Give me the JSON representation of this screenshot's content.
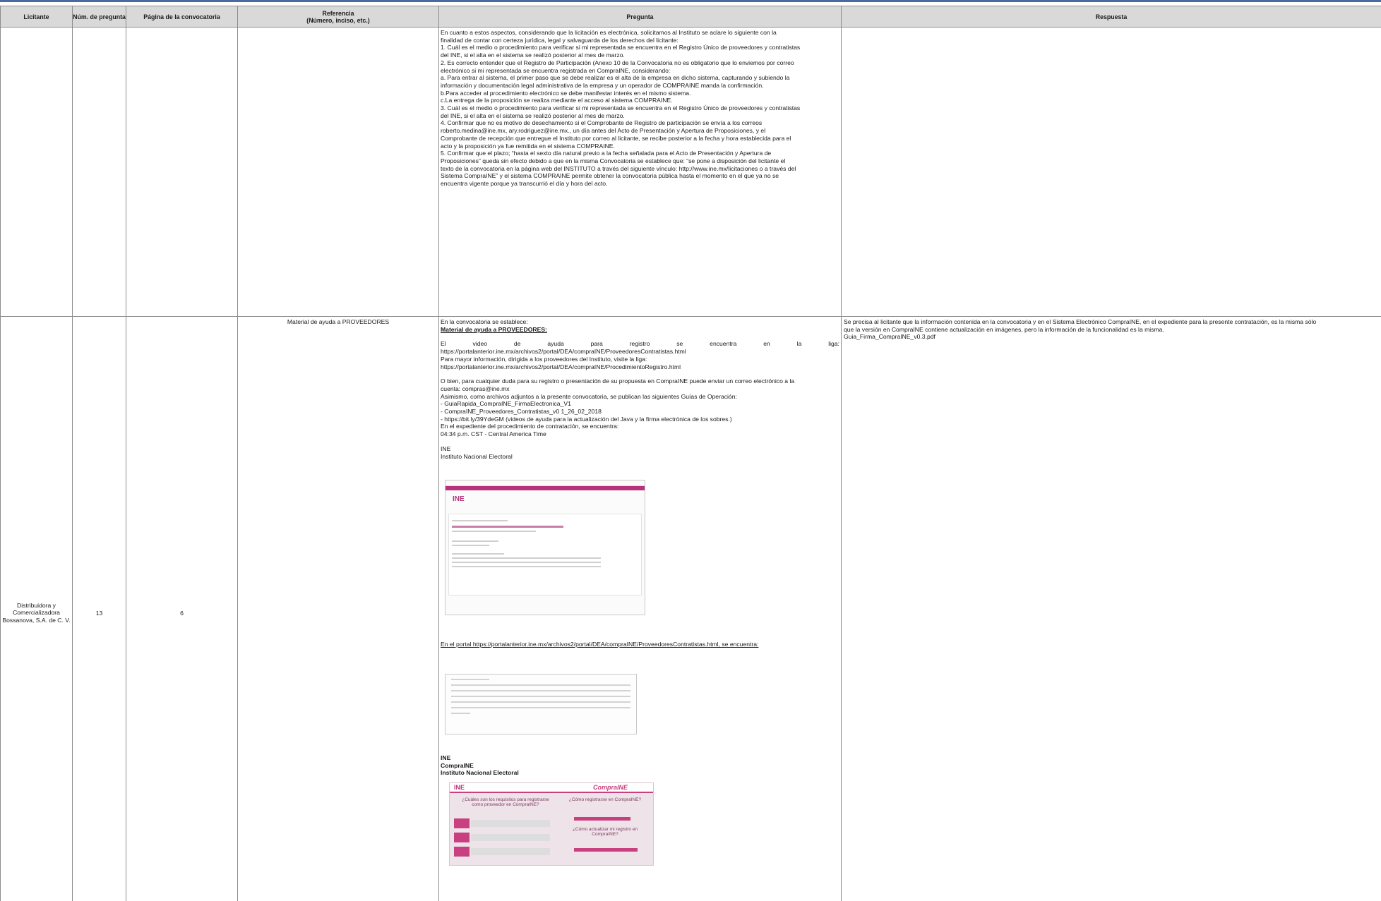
{
  "table": {
    "headers": {
      "licitante": "Licitante",
      "num_pregunta": "Núm. de pregunta",
      "pagina": "Página de la convocatoria",
      "referencia_l1": "Referencia",
      "referencia_l2": "(Número, inciso, etc.)",
      "pregunta": "Pregunta",
      "respuesta": "Respuesta"
    },
    "row1": {
      "pregunta_lines": [
        "En cuanto a estos aspectos, considerando que la licitación es electrónica, solicitamos al Instituto se aclare lo siguiente con la",
        "finalidad de contar con certeza jurídica, legal y salvaguarda de los derechos del licitante:",
        "1.  Cuál es el medio o procedimiento para verificar si mi representada se encuentra en el Registro Único de proveedores y contratistas",
        "del INE, si el alta en el sistema se realizó posterior al mes de marzo.",
        "2.  Es correcto entender que el Registro de Participación (Anexo 10 de la Convocatoria no es obligatorio que lo enviemos por correo",
        "electrónico si mi representada se encuentra registrada en CompraINE, considerando:",
        "a.  Para entrar al sistema, el primer paso que se debe realizar es el alta de la empresa en dicho sistema, capturando y subiendo la",
        "información y documentación legal administrativa de la empresa y un operador de COMPRAINE manda la confirmación.",
        "b.Para acceder al procedimiento electrónico se debe manifestar interés en el mismo sistema.",
        "c.La entrega de la proposición se realiza mediante el acceso al sistema COMPRAINE.",
        "3.  Cuál es el medio o procedimiento para verificar si mi representada se encuentra en el Registro Único de proveedores y contratistas",
        "del INE, si el alta en el sistema se realizó posterior al mes de marzo.",
        "4.  Confirmar que no es motivo de desechamiento si el Comprobante de Registro de participación se envía a los correos",
        "roberto.medina@ine.mx, ary.rodriguez@ine.mx., un día antes del Acto de Presentación y Apertura de Proposiciones, y el",
        "Comprobante de recepción que entregue el Instituto por correo al licitante, se recibe posterior a la fecha y hora establecida para el",
        "acto y la proposición ya fue remitida en el sistema COMPRAINE.",
        "5.  Confirmar que el plazo; “hasta el sexto día natural previo a la fecha señalada para el Acto de Presentación y Apertura de",
        "Proposiciones” queda sin efecto debido a que en la misma Convocatoria se establece que: “se pone a disposición del licitante el",
        "texto de la convocatoria en la página web del INSTITUTO a través del siguiente vínculo: http://www.ine.mx/licitaciones o a través del",
        "Sistema CompraINE” y el sistema COMPRAINE permite obtener la convocatoria pública hasta el momento en el que ya no se",
        "encuentra vigente porque ya transcurrió el día y hora del acto."
      ]
    },
    "row2": {
      "licitante": "Distribuidora y Comercializadora Bossanova, S.A. de C. V.",
      "num_pregunta": "13",
      "pagina": "6",
      "referencia": "Material de ayuda a PROVEEDORES",
      "pregunta": {
        "l1": "En la convocatoria se establece:",
        "l2": "Material de ayuda a PROVEEDORES:",
        "l3": "El video de ayuda para registro se encuentra en la liga:",
        "l4": "https://portalanterior.ine.mx/archivos2/portal/DEA/compraINE/ProveedoresContratistas.html",
        "l5": "Para mayor información, dirigida a los proveedores del Instituto, visite la liga:",
        "l6": "https://portalanterior.ine.mx/archivos2/portal/DEA/compraINE/ProcedimientoRegistro.html",
        "l7": "O bien, para cualquier duda para su registro o presentación de su propuesta en CompraINE puede enviar un correo electrónico a la",
        "l8": "cuenta: compras@ine.mx",
        "l9": "Asimismo, como archivos adjuntos a la presente convocatoria, se publican las siguientes Guías de Operación:",
        "l10": "- GuiaRapida_CompraINE_FirmaElectronica_V1",
        "l11": "- CompraINE_Proveedores_Contratistas_v0 1_26_02_2018",
        "l12": "- https://bit.ly/39YdeGM (videos de ayuda para la actualización del Java y la firma electrónica de los sobres.)",
        "l13": "En el expediente del procedimiento de contratación, se encuentra:",
        "l14": "04:34 p.m. CST - Central America Time",
        "l15": "INE",
        "l16": "Instituto Nacional Electoral",
        "l17": "En el portal https://portalanterior.ine.mx/archivos2/portal/DEA/compraINE/ProveedoresContratistas.html, se encuentra:",
        "l18": "INE",
        "l19": "CompraINE",
        "l20": "Instituto Nacional Electoral"
      },
      "screenshots": {
        "shot1_logo": "INE",
        "shot3_logo": "INE",
        "shot3_brand": "CompraINE",
        "shot3_q1": "¿Cuáles son los requisitos para registrarse como proveedor en CompraINE?",
        "shot3_q2": "¿Cómo registrarse en CompraINE?",
        "shot3_q3": "¿Cómo actualizar mi registro en CompraINE?"
      },
      "respuesta_l1": "Se precisa al licitante que la información contenida en la convocatoria y en el Sistema Electrónico CompraINE, en el expediente para la presente contratación, es la misma sólo",
      "respuesta_l2": "que la versión en CompraINE contiene  actualización en imágenes, pero la información de la funcionalidad es la misma.",
      "respuesta_l3": "Guia_Firma_CompraINE_v0.3.pdf"
    }
  },
  "colors": {
    "header_bg": "#d9d9d9",
    "border": "#8c8c8c",
    "ine_magenta": "#c8407f",
    "top_bar": "#4a6aa0"
  }
}
